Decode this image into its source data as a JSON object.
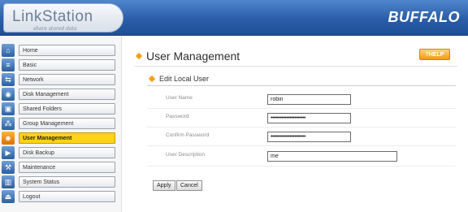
{
  "header": {
    "logo": "LinkStation",
    "tagline": "share stored data",
    "brand": "BUFFALO"
  },
  "sidebar": {
    "items": [
      {
        "label": "Home",
        "icon": "home-icon",
        "glyph": "⌂"
      },
      {
        "label": "Basic",
        "icon": "basic-icon",
        "glyph": "≡"
      },
      {
        "label": "Network",
        "icon": "network-icon",
        "glyph": "⇆"
      },
      {
        "label": "Disk Management",
        "icon": "disk-icon",
        "glyph": "◉"
      },
      {
        "label": "Shared Folders",
        "icon": "folder-icon",
        "glyph": "▣"
      },
      {
        "label": "Group Management",
        "icon": "group-icon",
        "glyph": "⁂"
      },
      {
        "label": "User Management",
        "icon": "user-icon",
        "glyph": "☻"
      },
      {
        "label": "Disk Backup",
        "icon": "backup-icon",
        "glyph": "▶"
      },
      {
        "label": "Maintenance",
        "icon": "maintenance-icon",
        "glyph": "⚒"
      },
      {
        "label": "System Status",
        "icon": "status-icon",
        "glyph": "▥"
      },
      {
        "label": "Logout",
        "icon": "logout-icon",
        "glyph": "⏏"
      }
    ],
    "active_label": "User Management"
  },
  "main": {
    "title": "User Management",
    "help_label": "?HELP",
    "section_title": "Edit Local User",
    "form": {
      "user_name_label": "User Name",
      "user_name_value": "robin",
      "password_label": "Password",
      "password_value": "••••••••••••••••••••••",
      "confirm_label": "Confirm Password",
      "confirm_value": "••••••••••••••••••••••",
      "description_label": "User Description",
      "description_value": "me"
    },
    "apply_label": "Apply",
    "cancel_label": "Cancel"
  },
  "colors": {
    "header_blue": "#2a5ea8",
    "active_nav": "#ffd21a",
    "accent_orange": "#f3a21a"
  }
}
